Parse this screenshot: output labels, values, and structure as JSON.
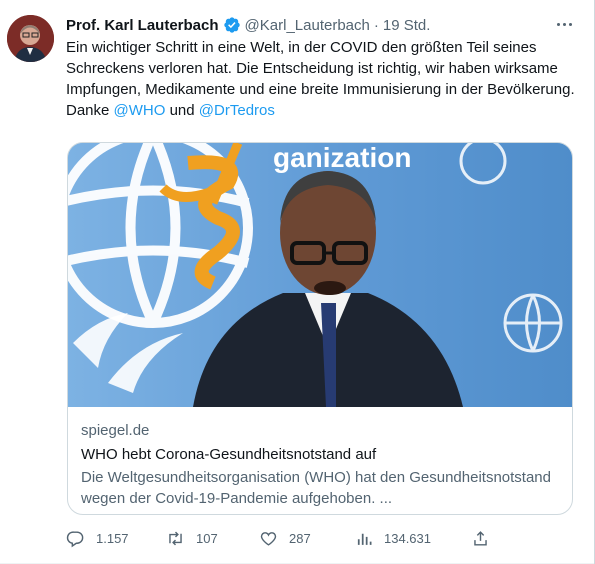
{
  "tweet": {
    "author_name": "Prof. Karl Lauterbach",
    "handle": "@Karl_Lauterbach",
    "separator": "·",
    "time": "19 Std.",
    "text_parts": {
      "body": "Ein wichtiger Schritt in eine Welt, in der COVID den größten Teil seines Schreckens verloren hat. Die Entscheidung ist richtig, wir haben wirksame Impfungen, Medikamente und eine breite Immunisierung in der Bevölkerung. Danke ",
      "mention1": "@WHO",
      "conj": " und ",
      "mention2": "@DrTedros"
    },
    "card": {
      "domain": "spiegel.de",
      "title": "WHO hebt Corona-Gesundheitsnotstand auf",
      "description": "Die Weltgesundheitsorganisation (WHO) hat den Gesundheitsnotstand wegen der Covid-19-Pandemie aufgehoben. ...",
      "image_text": "ganization"
    },
    "actions": {
      "replies": "1.157",
      "retweets": "107",
      "likes": "287",
      "views": "134.631"
    }
  },
  "colors": {
    "accent": "#1d9bf0",
    "muted": "#536471",
    "text": "#0f1419",
    "border": "#cfd9de",
    "who_blue": "#6fa7dc"
  },
  "icons": {
    "verified": "verified-badge-icon",
    "more": "more-icon",
    "reply": "reply-icon",
    "retweet": "retweet-icon",
    "like": "heart-icon",
    "views": "views-icon",
    "share": "share-icon"
  }
}
